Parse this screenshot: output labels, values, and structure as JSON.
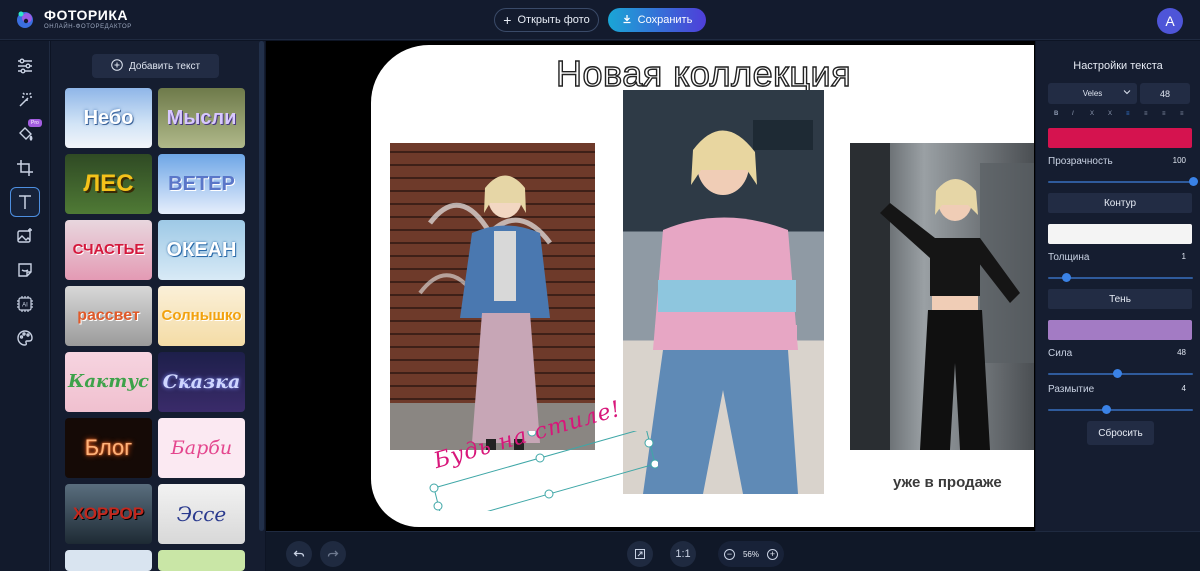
{
  "header": {
    "logo_title": "ФОТОРИКА",
    "logo_subtitle": "ОНЛАЙН-ФОТОРЕДАКТОР",
    "open_label": "Открыть фото",
    "save_label": "Сохранить",
    "avatar_letter": "A"
  },
  "tools": {
    "pro_badge": "Pro",
    "ai_label": "AI"
  },
  "templates": {
    "add_text_label": "Добавить текст",
    "items": [
      "Небо",
      "Мысли",
      "ЛЕС",
      "ВЕТЕР",
      "СЧАСТЬЕ",
      "ОКЕАН",
      "рассвет",
      "Солнышко",
      "Кактус",
      "Сказка",
      "Блог",
      "Барби",
      "ХОРРОР",
      "Эссе"
    ]
  },
  "canvas": {
    "headline": "Новая коллекция",
    "selected_text": "Будь на стиле!",
    "caption": "уже в продаже"
  },
  "bottom": {
    "fit_label": "1:1",
    "zoom_value": "56%",
    "zoom_minus": "−",
    "zoom_plus": "+"
  },
  "text_settings": {
    "title": "Настройки текста",
    "font": "Veles",
    "size": "48",
    "format_buttons": [
      "B",
      "I",
      "X",
      "X",
      "≡",
      "≡",
      "≡",
      "≡"
    ],
    "color": "#d5134f",
    "opacity_label": "Прозрачность",
    "opacity_value": "100",
    "opacity": 1.0,
    "outline_title": "Контур",
    "outline_color": "#f4f4f4",
    "thickness_label": "Толщина",
    "thickness_value": "1",
    "thickness": 0.13,
    "shadow_title": "Тень",
    "shadow_color": "#a37bc4",
    "strength_label": "Сила",
    "strength_value": "48",
    "strength": 0.48,
    "blur_label": "Размытие",
    "blur_value": "4",
    "blur": 0.4,
    "reset_label": "Сбросить"
  }
}
